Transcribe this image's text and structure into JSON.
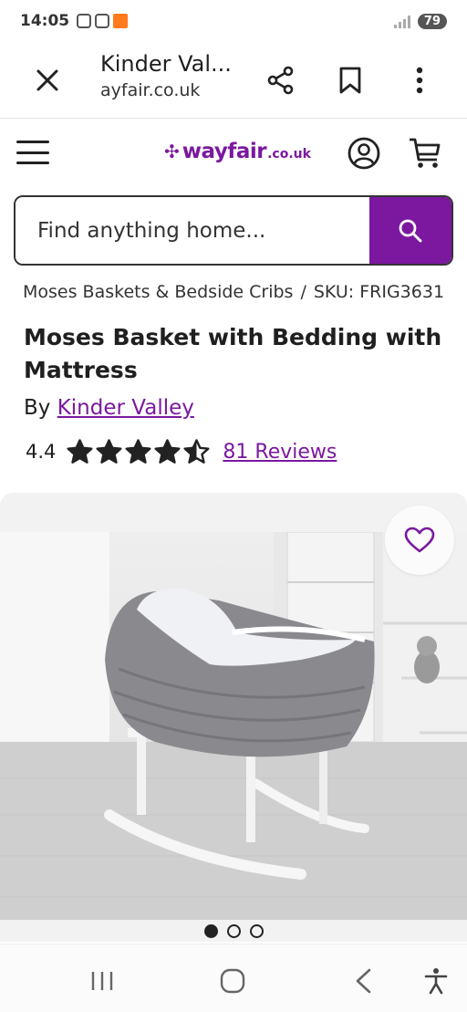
{
  "status_bar": {
    "time": "14:05",
    "battery": "79"
  },
  "tab": {
    "title": "Kinder Val...",
    "url": "ayfair.co.uk"
  },
  "site": {
    "logo_main": "wayfair",
    "logo_tld": ".co.uk",
    "brand_color": "#7b189f"
  },
  "search": {
    "placeholder": "Find anything home..."
  },
  "breadcrumb": {
    "category": "Moses Baskets & Bedside Cribs",
    "separator": "/",
    "sku": "SKU: FRIG3631"
  },
  "product": {
    "title": "Moses Basket with Bedding with Mattress",
    "by_prefix": "By",
    "brand": "Kinder Valley",
    "rating": "4.4",
    "rating_value": 4.4,
    "rating_max": 5,
    "reviews": "81 Reviews"
  },
  "gallery": {
    "image_count": 3,
    "active_index": 0
  },
  "icons": {
    "close": "close-icon",
    "share": "share-icon",
    "bookmark": "bookmark-icon",
    "more": "more-vert-icon",
    "menu": "hamburger-icon",
    "account": "account-icon",
    "cart": "cart-icon",
    "search": "search-icon",
    "wishlist": "heart-icon"
  }
}
